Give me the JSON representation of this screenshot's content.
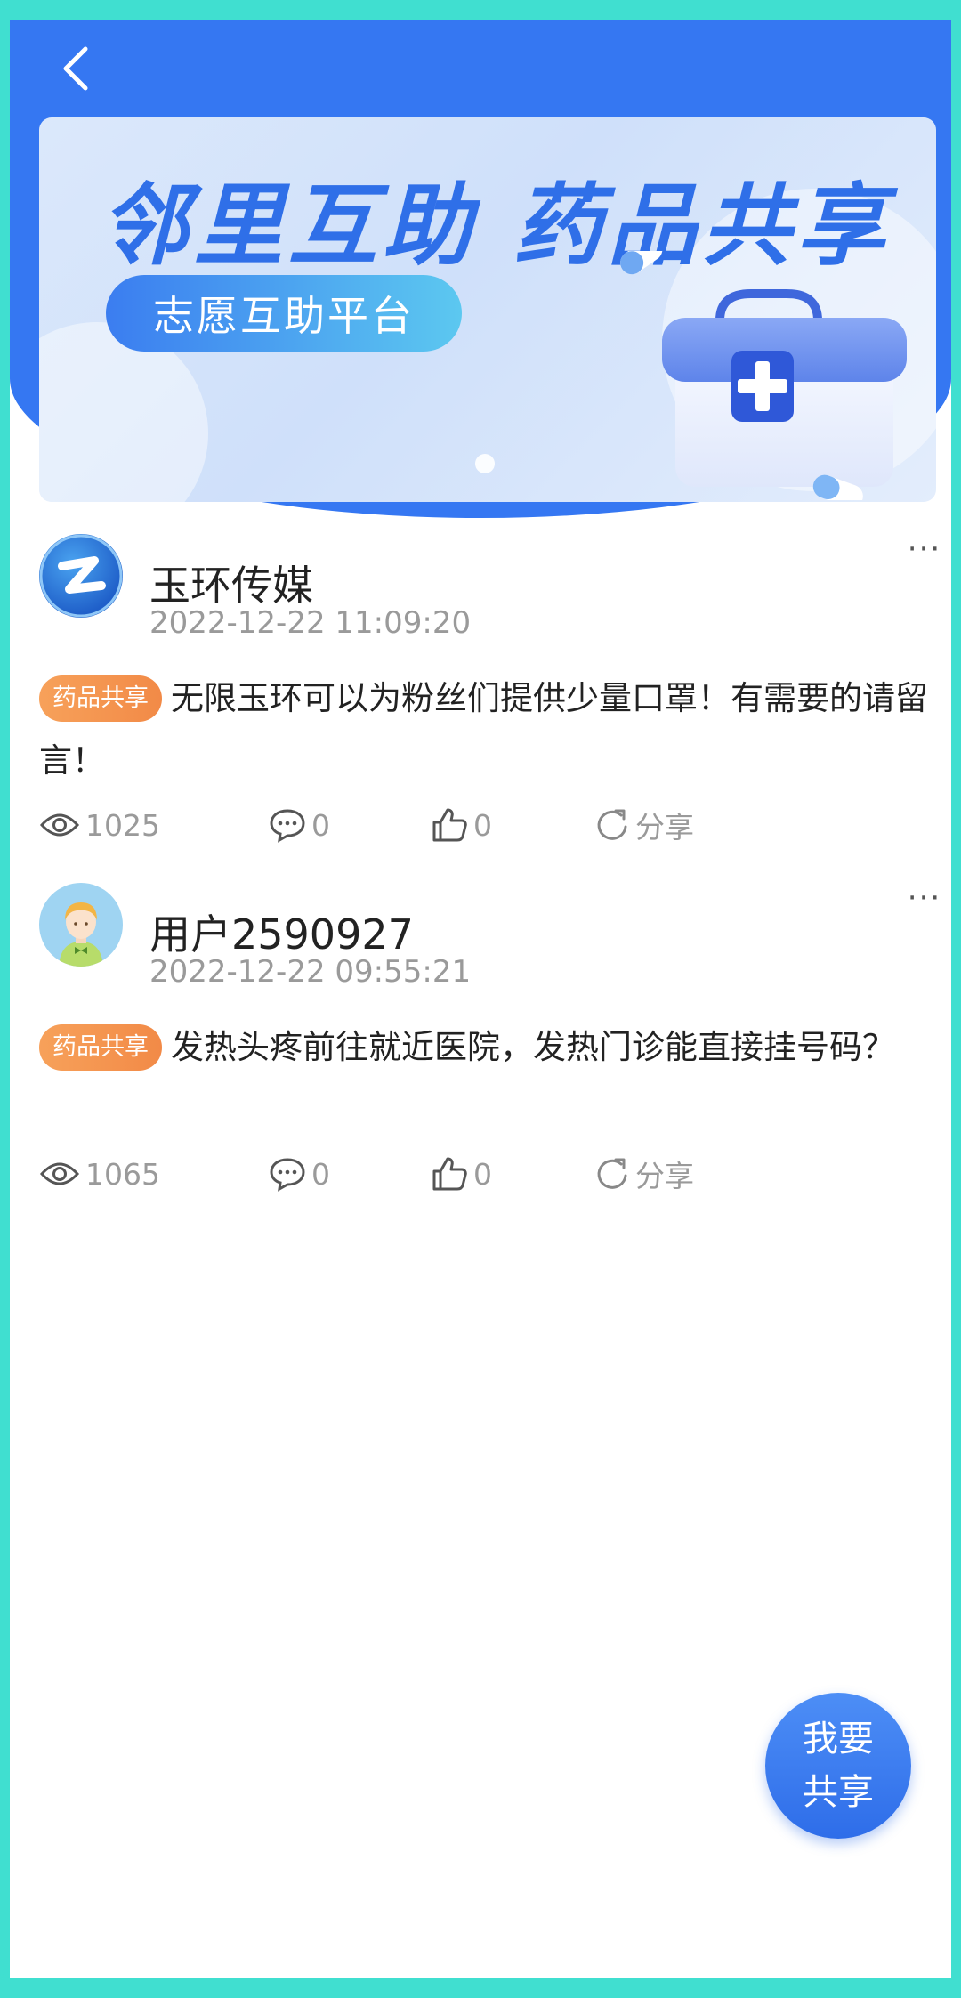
{
  "header": {
    "back_icon": "chevron-left-icon"
  },
  "banner": {
    "title": "邻里互助  药品共享",
    "subtitle": "志愿互助平台",
    "image": "medical-kit-illustration"
  },
  "posts": [
    {
      "author": "玉环传媒",
      "timestamp": "2022-12-22 11:09:20",
      "tag": "药品共享",
      "text": "无限玉环可以为粉丝们提供少量口罩！有需要的请留言！",
      "views": "1025",
      "comments": "0",
      "likes": "0",
      "share_label": "分享",
      "more_label": "···"
    },
    {
      "author": "用户2590927",
      "timestamp": "2022-12-22 09:55:21",
      "tag": "药品共享",
      "text": "发热头疼前往就近医院，发热门诊能直接挂号码？",
      "views": "1065",
      "comments": "0",
      "likes": "0",
      "share_label": "分享",
      "more_label": "···"
    }
  ],
  "fab": {
    "line1": "我要",
    "line2": "共享"
  },
  "colors": {
    "primary": "#3577f2",
    "tag": "#f28a47",
    "frame": "#40dfd0"
  }
}
